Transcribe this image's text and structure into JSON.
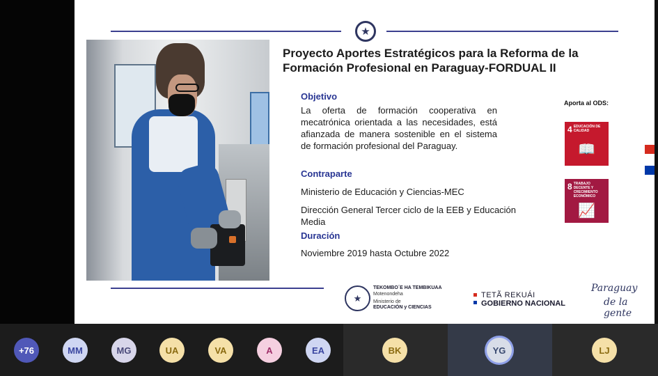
{
  "slide": {
    "title": "Proyecto Aportes Estratégicos para la Reforma de la Formación Profesional en Paraguay-FORDUAL II",
    "objetivo_heading": "Objetivo",
    "objetivo_text": "La oferta de formación cooperativa en mecatrónica orientada a las necesidades, está afianzada de manera sostenible en el sistema de formación profesional del Paraguay.",
    "contraparte_heading": "Contraparte",
    "contraparte_1": "Ministerio de Educación y Ciencias-MEC",
    "contraparte_2": "Dirección General Tercer ciclo de la EEB y Educación Media",
    "duracion_heading": "Duración",
    "duracion_text": "Noviembre 2019 hasta Octubre 2022",
    "ods_label": "Aporta al ODS:",
    "sdg4": {
      "number": "4",
      "label": "EDUCACIÓN DE CALIDAD",
      "color": "#c5192d"
    },
    "sdg8": {
      "number": "8",
      "label": "TRABAJO DECENTE Y CRECIMIENTO ECONÓMICO",
      "color": "#a21942"
    },
    "footer": {
      "mec_line1": "TEKOMBO´E HA TEMBIKUAA",
      "mec_line2": "Motenondeha",
      "mec_line3": "Ministerio de",
      "mec_line4": "EDUCACIÓN y CIENCIAS",
      "tetã_line1": "TETÃ REKUÁI",
      "tetã_line2": "GOBIERNO NACIONAL",
      "slogan_line1": "Paraguay",
      "slogan_line2": "de la gente"
    }
  },
  "participants": {
    "more": "+76",
    "avatars": [
      "MM",
      "MG",
      "UA",
      "VA",
      "A",
      "EA",
      "BK",
      "YG",
      "LJ"
    ]
  }
}
